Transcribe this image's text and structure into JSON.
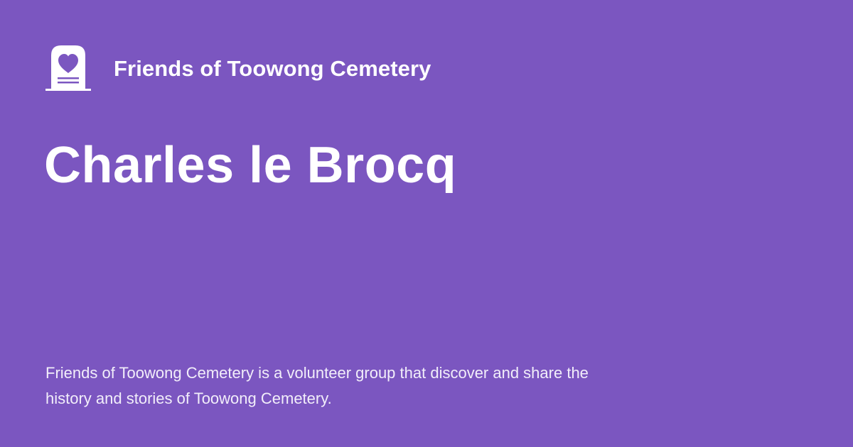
{
  "brand": {
    "name": "Friends of Toowong Cemetery",
    "logo_icon": "heart-headstone-icon"
  },
  "page": {
    "title": "Charles le Brocq",
    "description": "Friends of Toowong Cemetery is a volunteer group that discover and share the history and stories of Toowong Cemetery."
  },
  "colors": {
    "background": "#7b56c0",
    "text": "#ffffff",
    "logo_heart": "#7b56c0"
  }
}
